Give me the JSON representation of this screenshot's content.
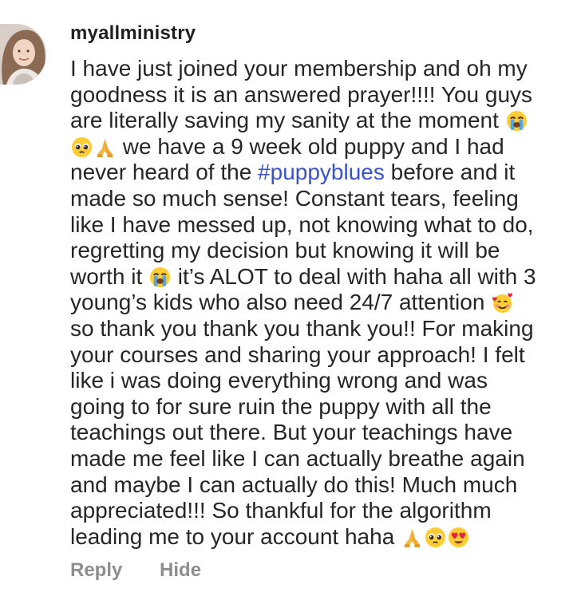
{
  "comment": {
    "username": "myallministry",
    "lines": [
      [
        "I have just joined your membership and oh my"
      ],
      [
        "goodness it is an answered prayer!!!! You guys"
      ],
      [
        "are literally saving my sanity at the moment "
      ],
      [
        "",
        " we have a 9 week old puppy and I had"
      ],
      [
        "never heard of the ",
        "#puppyblues",
        " before and it"
      ],
      [
        "made so much sense! Constant tears, feeling"
      ],
      [
        "like I have messed up, not knowing what to do,"
      ],
      [
        "regretting my decision but knowing it will be"
      ],
      [
        "worth it ",
        " it’s ALOT to deal with haha all with 3"
      ],
      [
        "young’s kids who also need 24/7 attention "
      ],
      [
        "so thank you thank you thank you!! For making"
      ],
      [
        "your courses and sharing your approach! I felt"
      ],
      [
        "like i was doing everything wrong and was"
      ],
      [
        "going to for sure ruin the puppy with all the"
      ],
      [
        "teachings out there. But your teachings have"
      ],
      [
        "made me feel like I can actually breathe again"
      ],
      [
        "and maybe I can actually do this! Much much"
      ],
      [
        "appreciated!!! So thankful for the algorithm"
      ],
      [
        "leading me to your account haha "
      ]
    ],
    "hashtag_color": "#3752d6",
    "emojis": {
      "crying": "loudly-crying-face-icon",
      "pleading": "pleading-face-icon",
      "praying": "folded-hands-icon",
      "hearts": "smiling-face-with-hearts-icon",
      "heart_eyes": "heart-eyes-icon"
    }
  },
  "actions": {
    "reply": "Reply",
    "hide": "Hide"
  }
}
